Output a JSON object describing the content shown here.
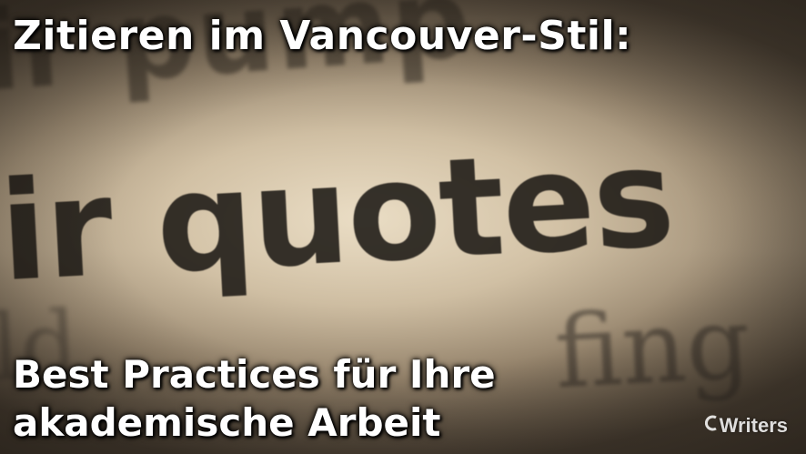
{
  "header": {
    "title": "Zitieren im Vancouver-Stil:"
  },
  "footer": {
    "subtitle_line1": "Best Practices für Ihre",
    "subtitle_line2": "akademische Arbeit",
    "logo_text": "Writers"
  },
  "photo": {
    "top_line": "ir pump",
    "main_line": "ir quotes",
    "bottom_left_line": "ld",
    "bottom_right_line": "fing"
  }
}
